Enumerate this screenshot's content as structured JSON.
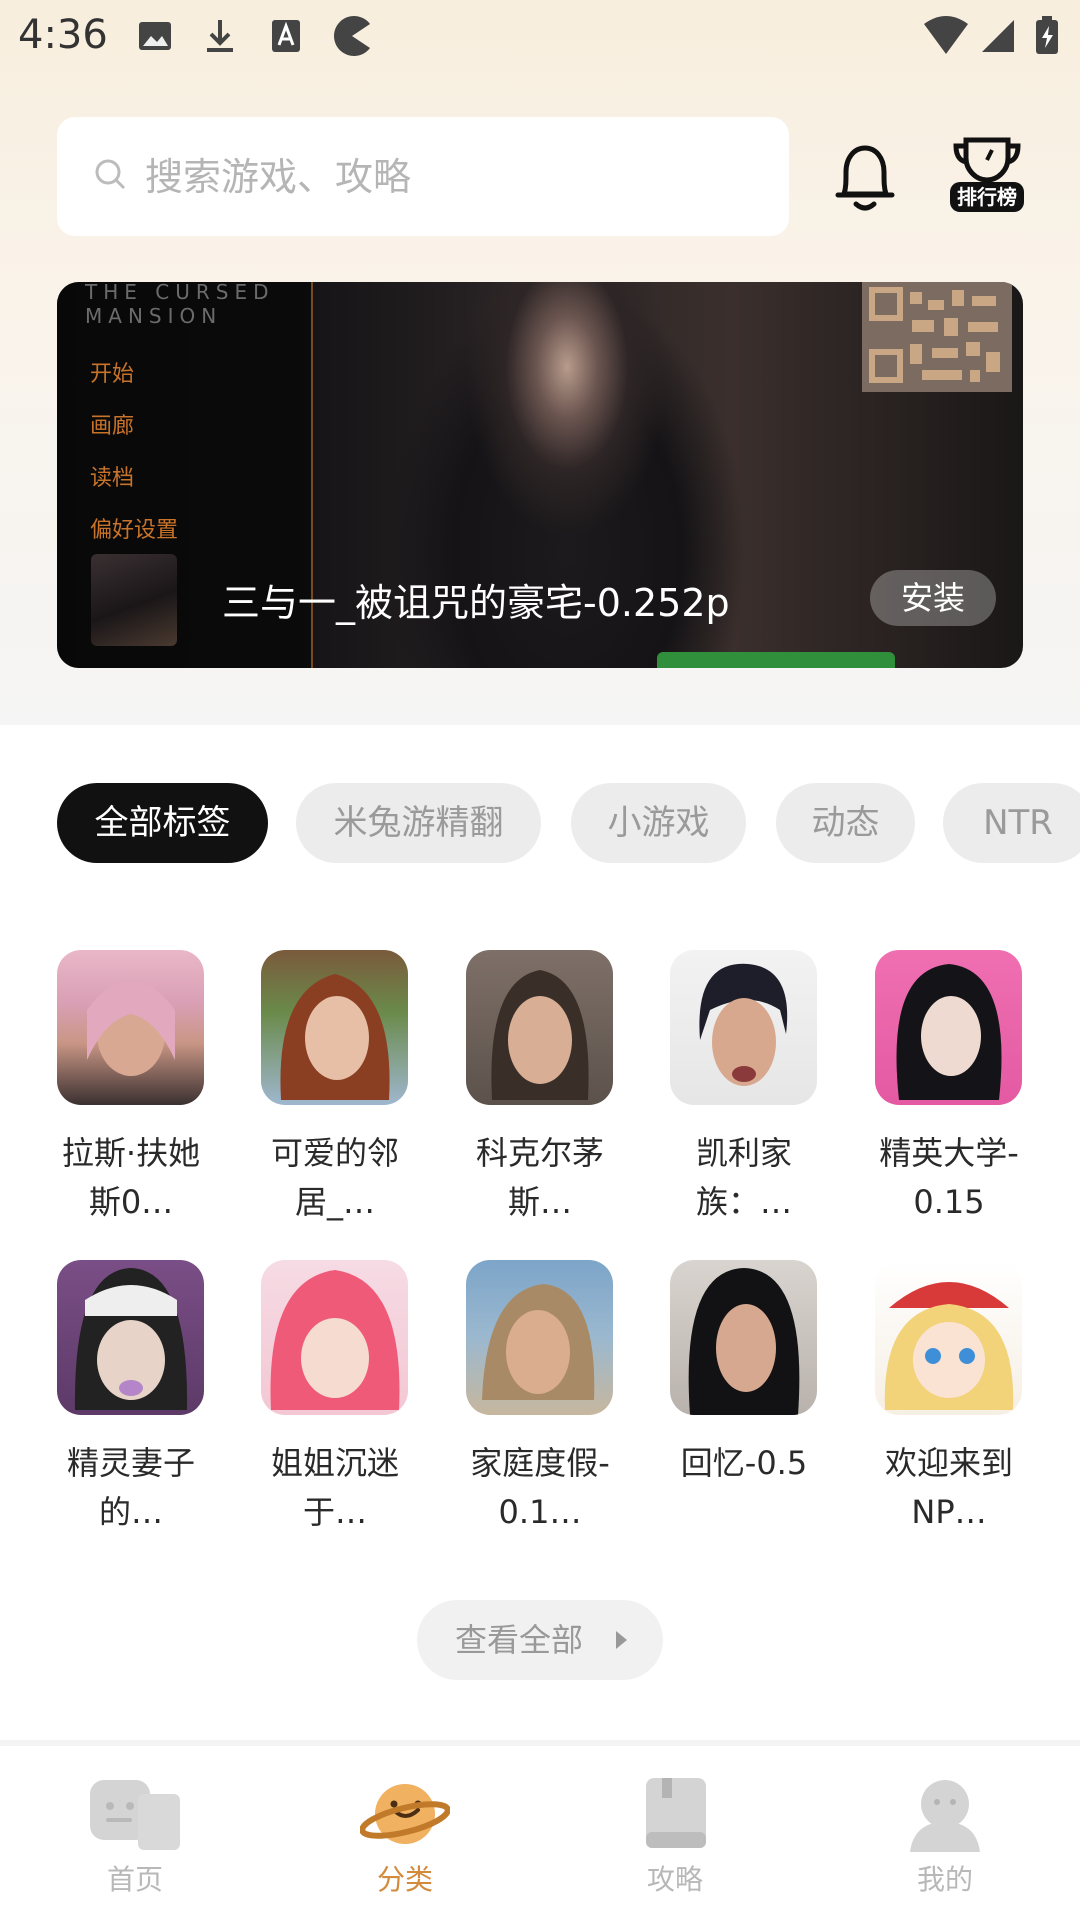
{
  "status_bar": {
    "time": "4:36",
    "left_icons": [
      "image-icon",
      "download-icon",
      "font-icon",
      "pacman-icon"
    ],
    "right_icons": [
      "wifi-icon",
      "signal-icon",
      "battery-icon"
    ]
  },
  "search": {
    "placeholder": "搜索游戏、攻略"
  },
  "header_actions": {
    "ranking_label": "排行榜"
  },
  "banner": {
    "game_title": "THE CURSED MANSION",
    "menu": [
      "开始",
      "画廊",
      "读档",
      "偏好设置"
    ],
    "title": "三与一_被诅咒的豪宅-0.252p",
    "install_label": "安装"
  },
  "tags": [
    {
      "label": "全部标签",
      "active": true
    },
    {
      "label": "米兔游精翻",
      "active": false
    },
    {
      "label": "小游戏",
      "active": false
    },
    {
      "label": "动态",
      "active": false
    },
    {
      "label": "NTR",
      "active": false
    }
  ],
  "games": [
    {
      "name": "拉斯·扶她斯0…"
    },
    {
      "name": "可爱的邻居_…"
    },
    {
      "name": "科克尔茅斯…"
    },
    {
      "name": "凯利家族：…"
    },
    {
      "name": "精英大学-0.15"
    },
    {
      "name": "精灵妻子的…"
    },
    {
      "name": "姐姐沉迷于…"
    },
    {
      "name": "家庭度假-0.1…"
    },
    {
      "name": "回忆-0.5"
    },
    {
      "name": "欢迎来到NP…"
    }
  ],
  "view_all_label": "查看全部",
  "bottom_nav": [
    {
      "label": "首页",
      "icon": "home-icon",
      "active": false
    },
    {
      "label": "分类",
      "icon": "planet-icon",
      "active": true
    },
    {
      "label": "攻略",
      "icon": "guide-book-icon",
      "active": false
    },
    {
      "label": "我的",
      "icon": "profile-icon",
      "active": false
    }
  ],
  "colors": {
    "accent": "#d28a3c",
    "tag_active_bg": "#111111",
    "tag_bg": "#ececec"
  }
}
